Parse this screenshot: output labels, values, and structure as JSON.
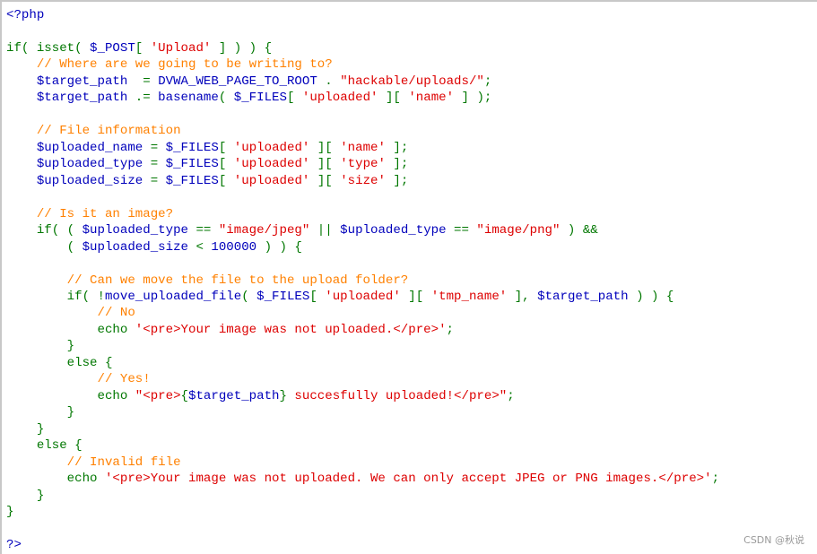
{
  "colors": {
    "keyword": "#007700",
    "variable": "#0000bb",
    "string": "#dd0000",
    "comment": "#ff8000"
  },
  "watermark": "CSDN @秋说",
  "lines": [
    [
      [
        "v",
        "<?php"
      ]
    ],
    [],
    [
      [
        "k",
        "if( isset( "
      ],
      [
        "v",
        "$_POST"
      ],
      [
        "k",
        "[ "
      ],
      [
        "s",
        "'Upload'"
      ],
      [
        "k",
        " ] ) ) {"
      ]
    ],
    [
      [
        "k",
        "    "
      ],
      [
        "c",
        "// Where are we going to be writing to?"
      ]
    ],
    [
      [
        "k",
        "    "
      ],
      [
        "v",
        "$target_path  "
      ],
      [
        "k",
        "= "
      ],
      [
        "v",
        "DVWA_WEB_PAGE_TO_ROOT "
      ],
      [
        "k",
        ". "
      ],
      [
        "s",
        "\"hackable/uploads/\""
      ],
      [
        "k",
        ";"
      ]
    ],
    [
      [
        "k",
        "    "
      ],
      [
        "v",
        "$target_path "
      ],
      [
        "k",
        ".= "
      ],
      [
        "v",
        "basename"
      ],
      [
        "k",
        "( "
      ],
      [
        "v",
        "$_FILES"
      ],
      [
        "k",
        "[ "
      ],
      [
        "s",
        "'uploaded'"
      ],
      [
        "k",
        " ][ "
      ],
      [
        "s",
        "'name'"
      ],
      [
        "k",
        " ] );"
      ]
    ],
    [],
    [
      [
        "k",
        "    "
      ],
      [
        "c",
        "// File information"
      ]
    ],
    [
      [
        "k",
        "    "
      ],
      [
        "v",
        "$uploaded_name "
      ],
      [
        "k",
        "= "
      ],
      [
        "v",
        "$_FILES"
      ],
      [
        "k",
        "[ "
      ],
      [
        "s",
        "'uploaded'"
      ],
      [
        "k",
        " ][ "
      ],
      [
        "s",
        "'name'"
      ],
      [
        "k",
        " ];"
      ]
    ],
    [
      [
        "k",
        "    "
      ],
      [
        "v",
        "$uploaded_type "
      ],
      [
        "k",
        "= "
      ],
      [
        "v",
        "$_FILES"
      ],
      [
        "k",
        "[ "
      ],
      [
        "s",
        "'uploaded'"
      ],
      [
        "k",
        " ][ "
      ],
      [
        "s",
        "'type'"
      ],
      [
        "k",
        " ];"
      ]
    ],
    [
      [
        "k",
        "    "
      ],
      [
        "v",
        "$uploaded_size "
      ],
      [
        "k",
        "= "
      ],
      [
        "v",
        "$_FILES"
      ],
      [
        "k",
        "[ "
      ],
      [
        "s",
        "'uploaded'"
      ],
      [
        "k",
        " ][ "
      ],
      [
        "s",
        "'size'"
      ],
      [
        "k",
        " ];"
      ]
    ],
    [],
    [
      [
        "k",
        "    "
      ],
      [
        "c",
        "// Is it an image?"
      ]
    ],
    [
      [
        "k",
        "    if( ( "
      ],
      [
        "v",
        "$uploaded_type "
      ],
      [
        "k",
        "== "
      ],
      [
        "s",
        "\"image/jpeg\""
      ],
      [
        "k",
        " || "
      ],
      [
        "v",
        "$uploaded_type "
      ],
      [
        "k",
        "== "
      ],
      [
        "s",
        "\"image/png\""
      ],
      [
        "k",
        " ) &&"
      ]
    ],
    [
      [
        "k",
        "        ( "
      ],
      [
        "v",
        "$uploaded_size "
      ],
      [
        "k",
        "< "
      ],
      [
        "v",
        "100000 "
      ],
      [
        "k",
        ") ) {"
      ]
    ],
    [],
    [
      [
        "k",
        "        "
      ],
      [
        "c",
        "// Can we move the file to the upload folder?"
      ]
    ],
    [
      [
        "k",
        "        if( !"
      ],
      [
        "v",
        "move_uploaded_file"
      ],
      [
        "k",
        "( "
      ],
      [
        "v",
        "$_FILES"
      ],
      [
        "k",
        "[ "
      ],
      [
        "s",
        "'uploaded'"
      ],
      [
        "k",
        " ][ "
      ],
      [
        "s",
        "'tmp_name'"
      ],
      [
        "k",
        " ], "
      ],
      [
        "v",
        "$target_path "
      ],
      [
        "k",
        ") ) {"
      ]
    ],
    [
      [
        "k",
        "            "
      ],
      [
        "c",
        "// No"
      ]
    ],
    [
      [
        "k",
        "            echo "
      ],
      [
        "s",
        "'<pre>Your image was not uploaded.</pre>'"
      ],
      [
        "k",
        ";"
      ]
    ],
    [
      [
        "k",
        "        }"
      ]
    ],
    [
      [
        "k",
        "        else {"
      ]
    ],
    [
      [
        "k",
        "            "
      ],
      [
        "c",
        "// Yes!"
      ]
    ],
    [
      [
        "k",
        "            echo "
      ],
      [
        "s",
        "\"<pre>"
      ],
      [
        "k",
        "{"
      ],
      [
        "v",
        "$target_path"
      ],
      [
        "k",
        "}"
      ],
      [
        "s",
        " succesfully uploaded!</pre>\""
      ],
      [
        "k",
        ";"
      ]
    ],
    [
      [
        "k",
        "        }"
      ]
    ],
    [
      [
        "k",
        "    }"
      ]
    ],
    [
      [
        "k",
        "    else {"
      ]
    ],
    [
      [
        "k",
        "        "
      ],
      [
        "c",
        "// Invalid file"
      ]
    ],
    [
      [
        "k",
        "        echo "
      ],
      [
        "s",
        "'<pre>Your image was not uploaded. We can only accept JPEG or PNG images.</pre>'"
      ],
      [
        "k",
        ";"
      ]
    ],
    [
      [
        "k",
        "    }"
      ]
    ],
    [
      [
        "k",
        "}"
      ]
    ],
    [],
    [
      [
        "v",
        "?>"
      ]
    ]
  ]
}
